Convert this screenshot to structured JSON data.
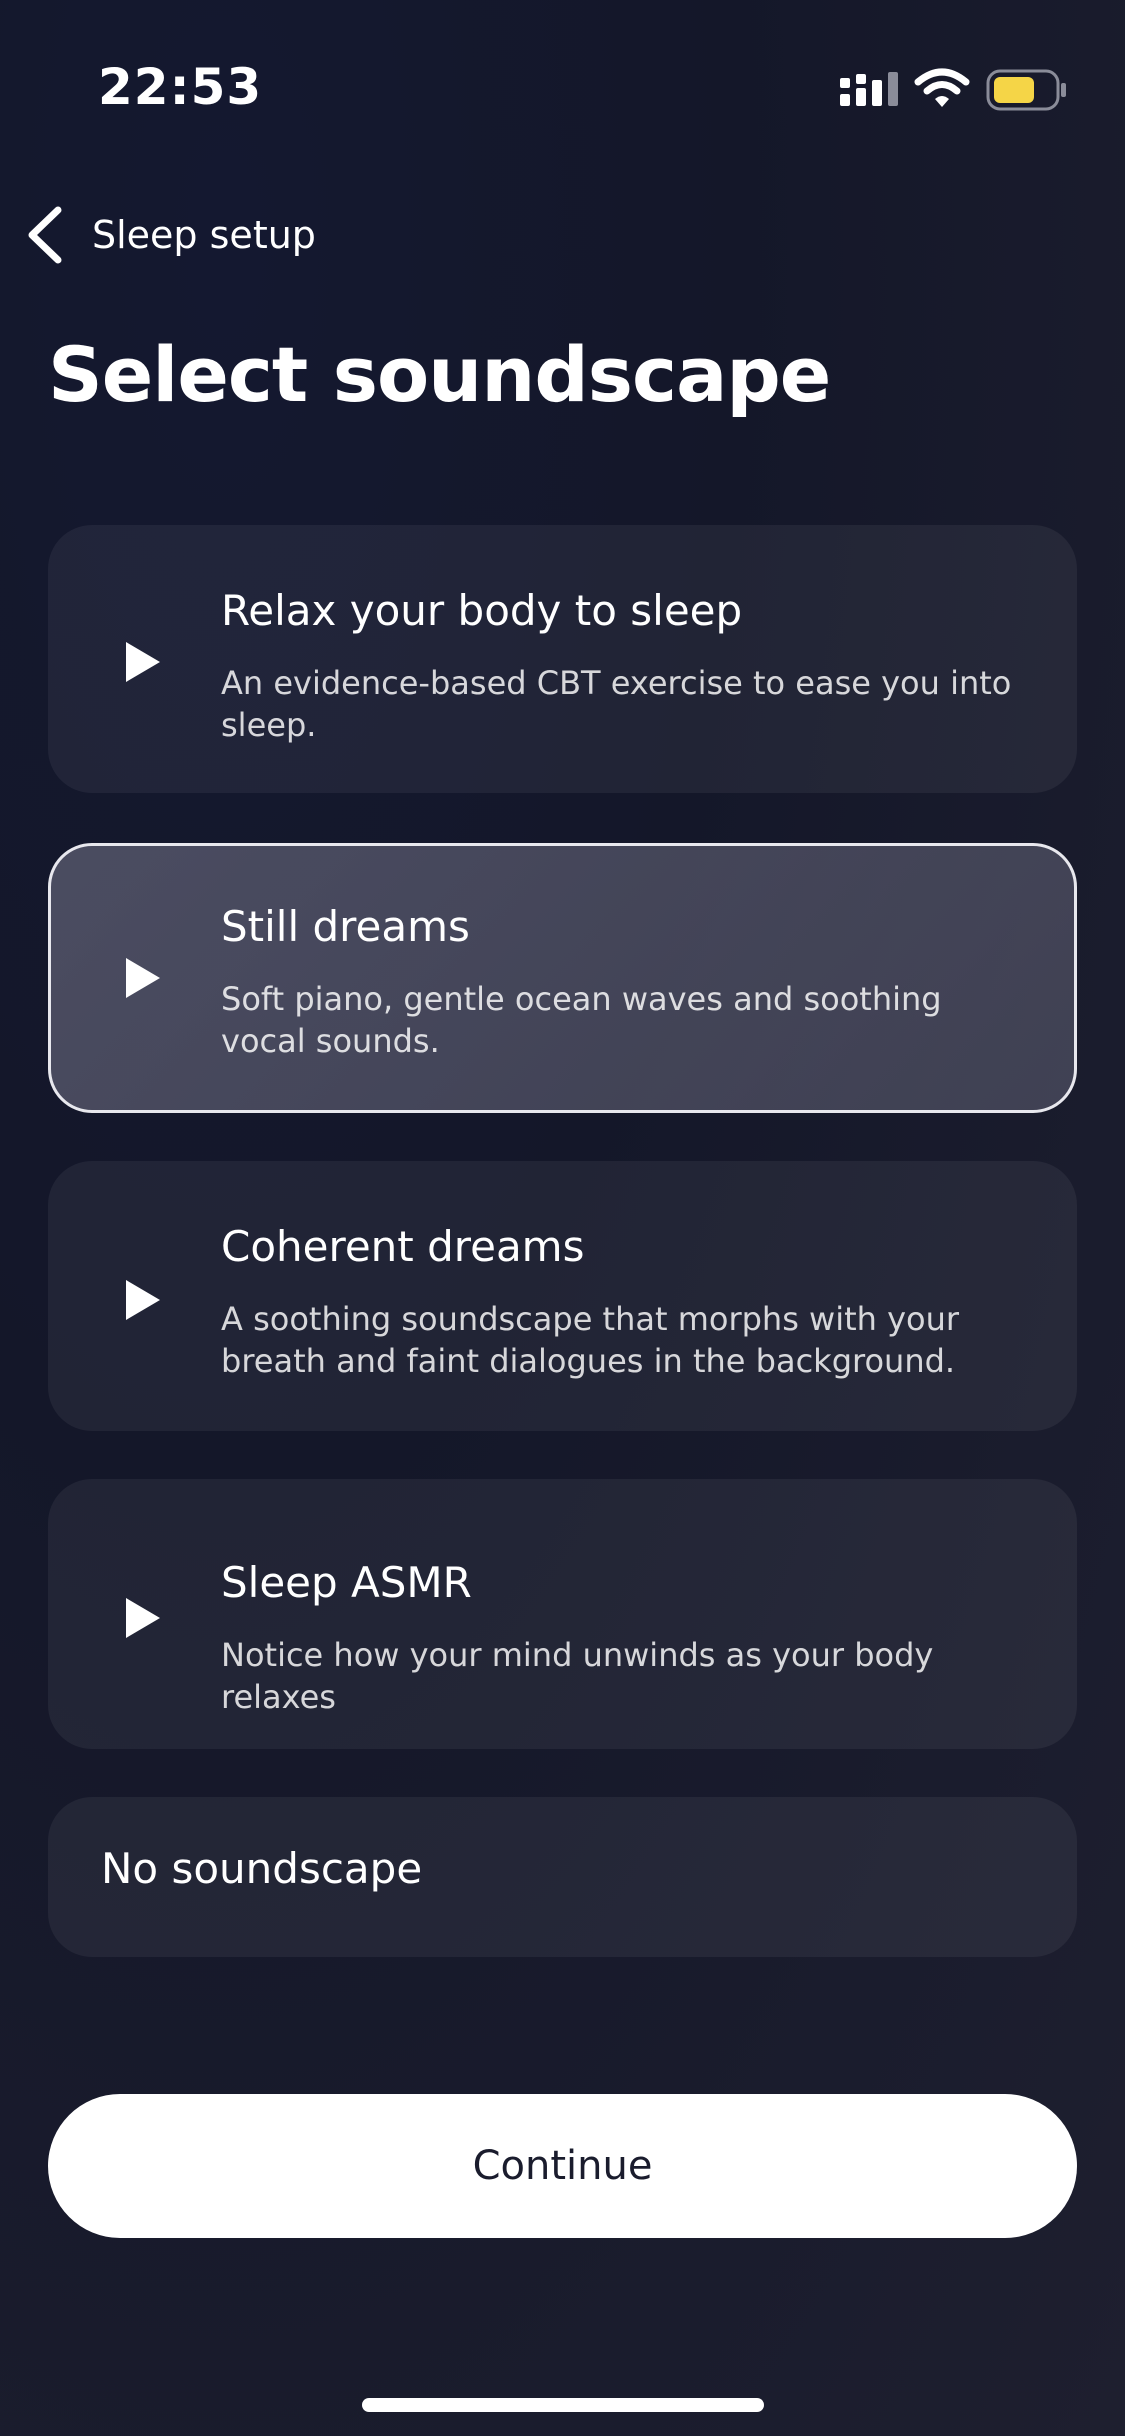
{
  "status": {
    "time": "22:53"
  },
  "nav": {
    "back_label": "Sleep setup"
  },
  "page": {
    "title": "Select soundscape"
  },
  "options": [
    {
      "title": "Relax your body to sleep",
      "description": "An evidence-based CBT exercise to ease you into sleep.",
      "selected": false,
      "icon": "play-icon"
    },
    {
      "title": "Still dreams",
      "description": "Soft piano, gentle ocean waves and soothing vocal sounds.",
      "selected": true,
      "icon": "play-icon"
    },
    {
      "title": "Coherent dreams",
      "description": "A soothing soundscape that morphs with your breath and faint dialogues in the background.",
      "selected": false,
      "icon": "play-icon"
    },
    {
      "title": "Sleep ASMR",
      "description": "Notice how your mind unwinds as your body relaxes",
      "selected": false,
      "icon": "play-icon"
    }
  ],
  "no_soundscape_label": "No soundscape",
  "continue_label": "Continue",
  "colors": {
    "background": "#161a2c",
    "battery_fill": "#f5d547",
    "selected_border": "#e8e8ee"
  }
}
